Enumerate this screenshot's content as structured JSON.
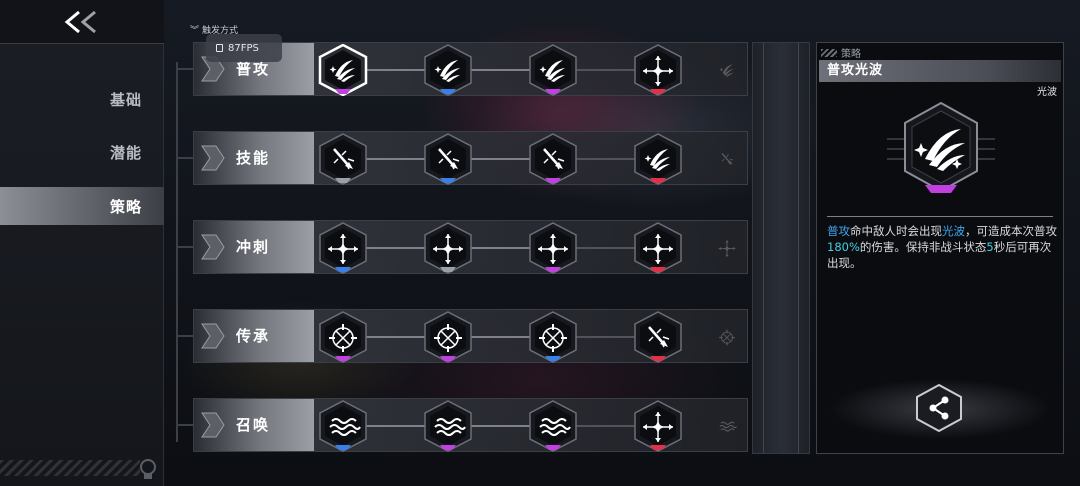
{
  "nav": {
    "back_icon": "double-chevron-left-icon",
    "items": [
      {
        "label": "基础",
        "active": false
      },
      {
        "label": "潜能",
        "active": false
      },
      {
        "label": "策略",
        "active": true
      }
    ]
  },
  "overlay": {
    "trigger_label": "触发方式",
    "fps": "87FPS"
  },
  "rows": [
    {
      "label": "普攻",
      "nodes": [
        {
          "icon": "claw-slash-icon",
          "accent": "#c040e0",
          "selected": true
        },
        {
          "icon": "claw-slash-icon",
          "accent": "#3a7ee8"
        },
        {
          "icon": "claw-slash-icon",
          "accent": "#c040e0"
        },
        {
          "icon": "crosshair-sparkle-icon",
          "accent": "#e0304a"
        }
      ]
    },
    {
      "label": "技能",
      "nodes": [
        {
          "icon": "burst-blade-icon",
          "accent": "#9aa0a8"
        },
        {
          "icon": "burst-blade-icon",
          "accent": "#3a7ee8"
        },
        {
          "icon": "burst-blade-icon",
          "accent": "#c040e0"
        },
        {
          "icon": "claw-slash-icon",
          "accent": "#e0304a"
        }
      ]
    },
    {
      "label": "冲刺",
      "nodes": [
        {
          "icon": "crosshair-sparkle-icon",
          "accent": "#3a7ee8"
        },
        {
          "icon": "crosshair-sparkle-icon",
          "accent": "#9aa0a8"
        },
        {
          "icon": "crosshair-sparkle-icon",
          "accent": "#c040e0"
        },
        {
          "icon": "crosshair-sparkle-icon",
          "accent": "#e0304a"
        }
      ]
    },
    {
      "label": "传承",
      "nodes": [
        {
          "icon": "target-reticle-icon",
          "accent": "#c040e0"
        },
        {
          "icon": "target-reticle-icon",
          "accent": "#c040e0"
        },
        {
          "icon": "target-reticle-icon",
          "accent": "#3a7ee8"
        },
        {
          "icon": "burst-blade-icon",
          "accent": "#e0304a"
        }
      ]
    },
    {
      "label": "召唤",
      "nodes": [
        {
          "icon": "wave-spirit-icon",
          "accent": "#3a7ee8"
        },
        {
          "icon": "wave-spirit-icon",
          "accent": "#c040e0"
        },
        {
          "icon": "wave-spirit-icon",
          "accent": "#c040e0"
        },
        {
          "icon": "crosshair-sparkle-icon",
          "accent": "#e0304a"
        }
      ]
    }
  ],
  "detail": {
    "tag": "策略",
    "title": "普攻光波",
    "subtitle": "光波",
    "icon": "claw-slash-icon",
    "desc_segments": [
      {
        "text": "普攻",
        "color": "#3fa6f0"
      },
      {
        "text": "命中敌人时会出现",
        "color": null
      },
      {
        "text": "光波",
        "color": "#3fa6f0"
      },
      {
        "text": "，可造成本次普攻",
        "color": null
      },
      {
        "text": "180%",
        "color": "#3fd0e0"
      },
      {
        "text": "的伤害。保持非战斗状态",
        "color": null
      },
      {
        "text": "5",
        "color": "#3fd0e0"
      },
      {
        "text": "秒后可再次出现。",
        "color": null
      }
    ],
    "share_icon": "share-icon"
  }
}
